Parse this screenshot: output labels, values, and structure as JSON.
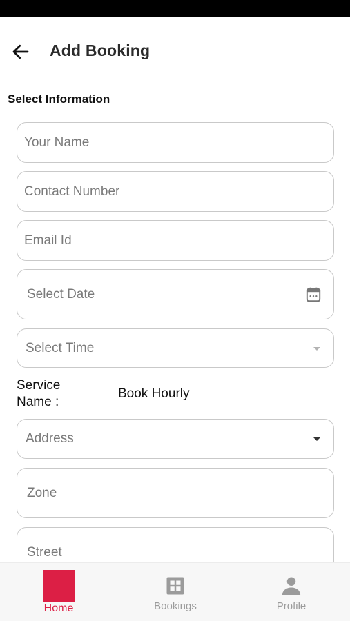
{
  "header": {
    "title": "Add Booking",
    "back_icon": "arrow-left-icon"
  },
  "form": {
    "section_title": "Select Information",
    "name_placeholder": "Your Name",
    "contact_placeholder": "Contact Number",
    "email_placeholder": "Email Id",
    "date_placeholder": "Select Date",
    "date_icon": "calendar-icon",
    "time_placeholder": "Select Time",
    "service_label": "Service Name :",
    "service_value": "Book Hourly",
    "address_placeholder": "Address",
    "zone_placeholder": "Zone",
    "street_placeholder": "Street"
  },
  "bottom_nav": {
    "items": [
      {
        "label": "Home",
        "icon": "home-square-icon",
        "active": true
      },
      {
        "label": "Bookings",
        "icon": "grid-icon",
        "active": false
      },
      {
        "label": "Profile",
        "icon": "person-icon",
        "active": false
      }
    ]
  },
  "colors": {
    "accent": "#dc1f45",
    "inactive": "#9b9b9b",
    "border": "#c9c9c9"
  }
}
